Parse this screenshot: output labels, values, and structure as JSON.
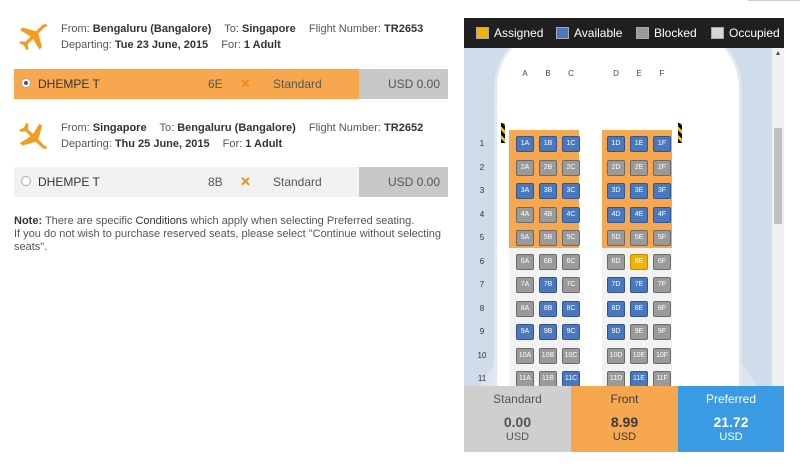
{
  "flights": [
    {
      "from_label": "From:",
      "from": "Bengaluru (Bangalore)",
      "to_label": "To:",
      "to": "Singapore",
      "flight_label": "Flight Number:",
      "flight_number": "TR2653",
      "departing_label": "Departing:",
      "departing": "Tue 23 June, 2015",
      "for_label": "For:",
      "for": "1 Adult",
      "passenger": {
        "name": "DHEMPE T",
        "seat": "6E",
        "type": "Standard",
        "price": "USD 0.00",
        "selected": true
      }
    },
    {
      "from_label": "From:",
      "from": "Singapore",
      "to_label": "To:",
      "to": "Bengaluru (Bangalore)",
      "flight_label": "Flight Number:",
      "flight_number": "TR2652",
      "departing_label": "Departing:",
      "departing": "Thu 25 June, 2015",
      "for_label": "For:",
      "for": "1 Adult",
      "passenger": {
        "name": "DHEMPE T",
        "seat": "8B",
        "type": "Standard",
        "price": "USD 0.00",
        "selected": false
      }
    }
  ],
  "note": {
    "label": "Note:",
    "text1": " There are specific ",
    "conditions_link": "Conditions",
    "text2": " which apply when selecting Preferred seating.",
    "text3": "If you do not wish to purchase reserved seats, please select \"Continue without selecting seats\"."
  },
  "legend": {
    "assigned": "Assigned",
    "available": "Available",
    "blocked": "Blocked",
    "occupied": "Occupied"
  },
  "colors": {
    "assigned": "#f0b400",
    "available": "#4a78bf",
    "blocked": "#9a9a9a",
    "occupied": "#d6d6d6",
    "front_accent": "#f7a84f",
    "preferred_accent": "#3a9be3"
  },
  "columns": [
    "A",
    "B",
    "C",
    "D",
    "E",
    "F"
  ],
  "seat_rows": [
    {
      "row": "1",
      "seats": [
        "available",
        "available",
        "available",
        "available",
        "available",
        "available"
      ]
    },
    {
      "row": "2",
      "seats": [
        "blocked",
        "blocked",
        "blocked",
        "blocked",
        "blocked",
        "blocked"
      ]
    },
    {
      "row": "3",
      "seats": [
        "available",
        "available",
        "available",
        "available",
        "available",
        "available"
      ]
    },
    {
      "row": "4",
      "seats": [
        "blocked",
        "blocked",
        "available",
        "available",
        "available",
        "available"
      ]
    },
    {
      "row": "5",
      "seats": [
        "blocked",
        "blocked",
        "blocked",
        "blocked",
        "blocked",
        "blocked"
      ]
    },
    {
      "row": "6",
      "seats": [
        "blocked",
        "blocked",
        "blocked",
        "blocked",
        "assigned",
        "blocked"
      ]
    },
    {
      "row": "7",
      "seats": [
        "blocked",
        "available",
        "blocked",
        "available",
        "available",
        "blocked"
      ]
    },
    {
      "row": "8",
      "seats": [
        "blocked",
        "available",
        "available",
        "available",
        "available",
        "blocked"
      ]
    },
    {
      "row": "9",
      "seats": [
        "available",
        "available",
        "available",
        "available",
        "blocked",
        "blocked"
      ]
    },
    {
      "row": "10",
      "seats": [
        "blocked",
        "blocked",
        "blocked",
        "blocked",
        "blocked",
        "blocked"
      ]
    },
    {
      "row": "11",
      "seats": [
        "blocked",
        "blocked",
        "available",
        "blocked",
        "available",
        "blocked"
      ]
    }
  ],
  "tiers": [
    {
      "name": "Standard",
      "price": "0.00",
      "currency": "USD"
    },
    {
      "name": "Front",
      "price": "8.99",
      "currency": "USD"
    },
    {
      "name": "Preferred",
      "price": "21.72",
      "currency": "USD"
    }
  ]
}
